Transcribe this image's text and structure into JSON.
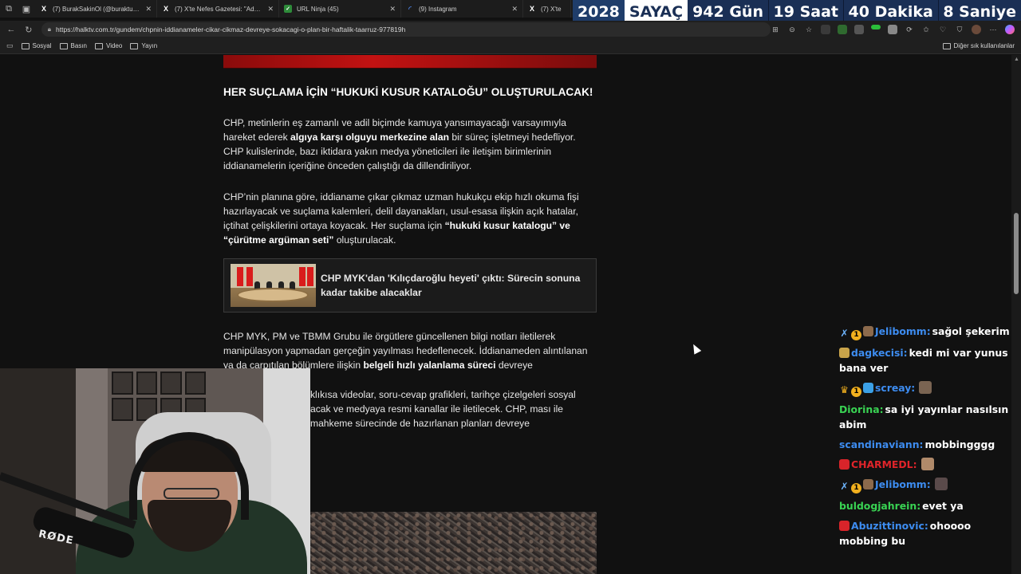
{
  "tabs": [
    {
      "icon": "x-logo-icon",
      "title": "(7) BurakSakinOl (@buraktut_) / X"
    },
    {
      "icon": "x-logo-icon",
      "title": "(7) X'te Nefes Gazetesi: \"Adana..."
    },
    {
      "icon": "url-ninja-icon",
      "title": "URL Ninja (45)"
    },
    {
      "icon": "instagram-icon",
      "title": "(9) Instagram"
    },
    {
      "icon": "x-logo-icon",
      "title": "(7) X'te"
    }
  ],
  "countdown": {
    "year": "2028",
    "label": "SAYAÇ",
    "days": "942 Gün",
    "hours": "19 Saat",
    "minutes": "40 Dakika",
    "seconds": "8 Saniye"
  },
  "address": {
    "url": "https://halktv.com.tr/gundem/chpnin-iddianameler-cikar-cikmaz-devreye-sokacagi-o-plan-bir-haftalik-taarruz-977819h"
  },
  "bookmarks": {
    "items": [
      "Sosyal",
      "Basın",
      "Video",
      "Yayın"
    ],
    "other": "Diğer sık kullanılanlar"
  },
  "article": {
    "heading": "HER SUÇLAMA İÇİN “HUKUKİ KUSUR KATALOĞU” OLUŞTURULACAK!",
    "p1_a": "CHP, metinlerin eş zamanlı ve adil biçimde kamuya yansımayacağı varsayımıyla hareket ederek ",
    "p1_b": "algıya karşı olguyu merkezine alan",
    "p1_c": " bir süreç işletmeyi hedefliyor. CHP kulislerinde, bazı iktidara yakın medya yöneticileri ile iletişim birimlerinin iddianamelerin içeriğine önceden çalıştığı da dillendiriliyor.",
    "p2_a": "CHP’nin planına göre, iddianame çıkar çıkmaz uzman hukukçu ekip hızlı okuma fişi hazırlayacak ve suçlama kalemleri, delil dayanakları, usul-esasa ilişkin açık hatalar, içtihat çelişkilerini ortaya koyacak. Her suçlama için ",
    "p2_b": "“hukuki kusur katalogu” ve “çürütme argüman seti”",
    "p2_c": " oluşturulacak.",
    "related_title": "CHP MYK'dan 'Kılıçdaroğlu heyeti' çıktı: Sürecin sonuna kadar takibe alacaklar",
    "p3_a": "CHP MYK, PM ve TBMM Grubu ile örgütlere güncellenen bilgi notları iletilerek manipülasyon yapmadan gerçeğin yayılması hedeflenecek. İddianameden alıntılanan ya da çarpıtılan bölümlere ilişkin ",
    "p3_b": "belgeli hızlı yalanlama süreci",
    "p3_c": " devreye",
    "p4": "kısa videolar, soru-cevap grafikleri, tarihçe çizelgeleri sosyal acak ve medyaya resmi kanallar ile iletilecek. CHP, ması ile mahkeme sürecinde de hazırlanan planları devreye",
    "p4_prefix": "klı"
  },
  "webcam": {
    "mic_brand": "RØDE"
  },
  "chat": [
    {
      "badges": [
        "sword",
        "coin",
        "pic"
      ],
      "user": "Jelibomm:",
      "color": "#3d8cf0",
      "text": "sağol şekerim"
    },
    {
      "badges": [
        "pic-yellow"
      ],
      "user": "dagkecisi:",
      "color": "#3d8cf0",
      "text": "kedi mi var yunus bana ver"
    },
    {
      "badges": [
        "crown",
        "coin",
        "cube"
      ],
      "user": "screay:",
      "color": "#3d8cf0",
      "text": ""
    },
    {
      "badges": [],
      "user": "Diorina:",
      "color": "#39d353",
      "text": "sa iyi yayınlar nasılsın abim"
    },
    {
      "badges": [],
      "user": "scandinaviann:",
      "color": "#3d8cf0",
      "text": "mobbingggg"
    },
    {
      "badges": [
        "red"
      ],
      "user": "CHARMEDL:",
      "color": "#e0242a",
      "text": ""
    },
    {
      "badges": [
        "sword",
        "coin",
        "pic"
      ],
      "user": "Jelibomm:",
      "color": "#3d8cf0",
      "text": ""
    },
    {
      "badges": [],
      "user": "buldogjahrein:",
      "color": "#39d353",
      "text": "evet ya"
    },
    {
      "badges": [
        "red"
      ],
      "user": "Abuzittinovic:",
      "color": "#3d8cf0",
      "text": "ohoooo mobbing bu"
    }
  ],
  "colors": {
    "accent_red": "#c21212",
    "chat_blue": "#3d8cf0",
    "chat_green": "#39d353",
    "countdown_bg": "#1a2f55"
  }
}
